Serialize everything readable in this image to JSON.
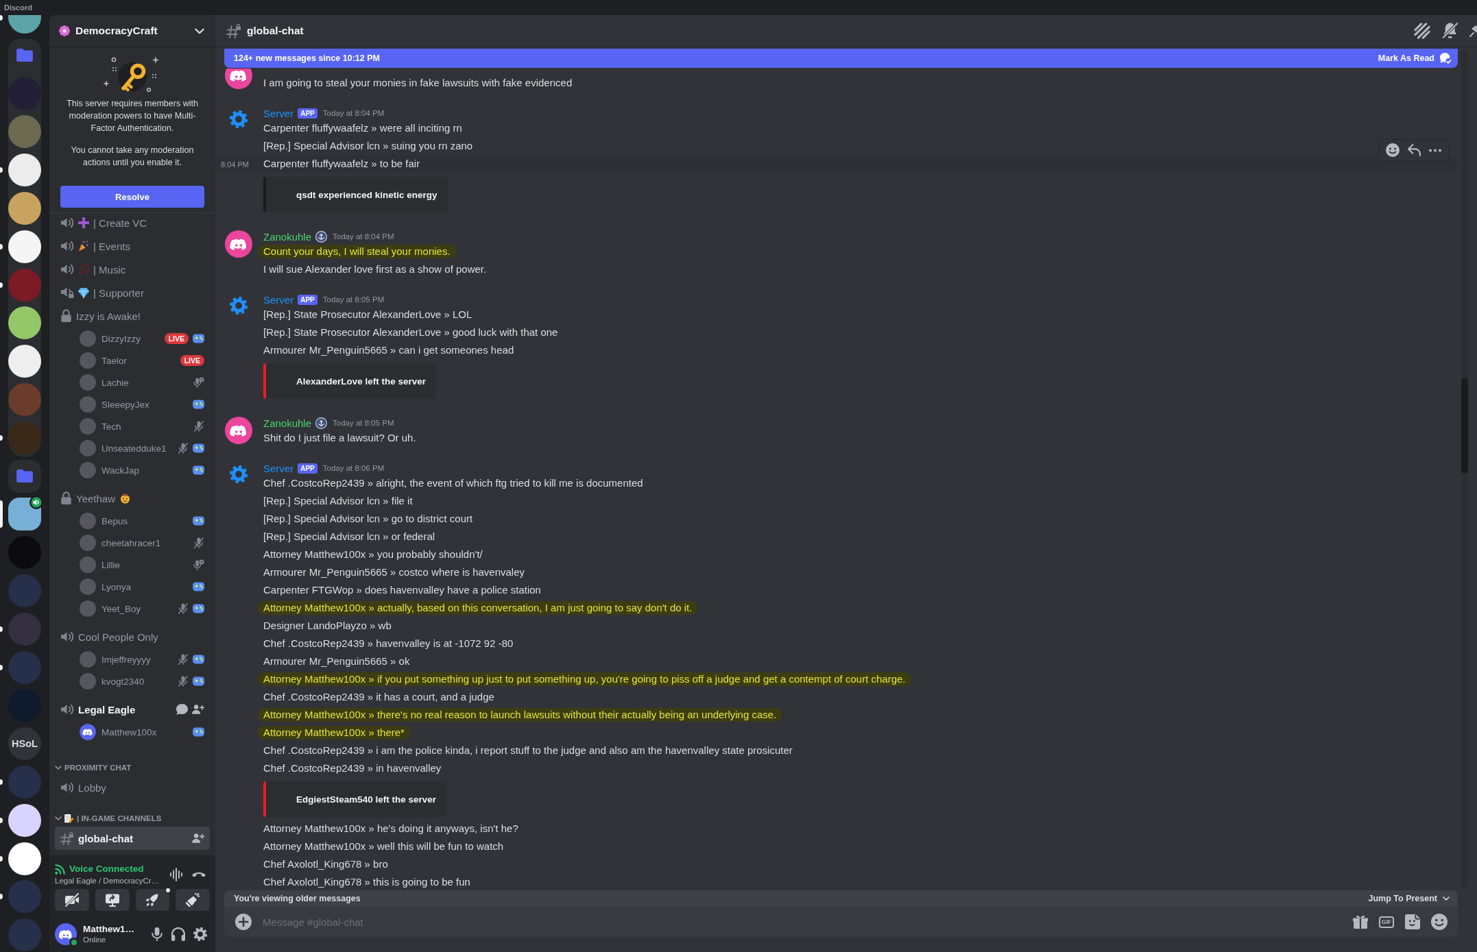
{
  "app": {
    "title": "Discord"
  },
  "servers": [
    {
      "kind": "server",
      "unread": true,
      "selected": false,
      "in_voice": false
    },
    {
      "kind": "folder",
      "children": [
        {
          "kind": "server",
          "unread": false,
          "selected": false,
          "in_voice": false
        },
        {
          "kind": "server",
          "unread": false,
          "selected": false,
          "in_voice": false
        },
        {
          "kind": "server",
          "unread": true,
          "selected": false,
          "in_voice": false
        },
        {
          "kind": "server",
          "unread": false,
          "selected": false,
          "in_voice": false
        },
        {
          "kind": "server",
          "unread": true,
          "selected": false,
          "in_voice": false
        },
        {
          "kind": "server",
          "unread": true,
          "selected": false,
          "in_voice": false
        },
        {
          "kind": "server",
          "unread": false,
          "selected": false,
          "in_voice": false
        },
        {
          "kind": "server",
          "unread": false,
          "selected": false,
          "in_voice": false
        },
        {
          "kind": "server",
          "unread": false,
          "selected": false,
          "in_voice": false
        },
        {
          "kind": "server",
          "unread": true,
          "selected": false,
          "in_voice": false
        }
      ]
    },
    {
      "kind": "folder"
    },
    {
      "kind": "server",
      "unread": false,
      "selected": true,
      "in_voice": true
    },
    {
      "kind": "server",
      "unread": false,
      "selected": false,
      "in_voice": false
    },
    {
      "kind": "server",
      "unread": false,
      "selected": false,
      "in_voice": false
    },
    {
      "kind": "server",
      "unread": true,
      "selected": false,
      "in_voice": false
    },
    {
      "kind": "server",
      "unread": true,
      "selected": false,
      "in_voice": false
    },
    {
      "kind": "server",
      "unread": false,
      "selected": false,
      "in_voice": false
    },
    {
      "kind": "acronym",
      "label": "HSoL",
      "unread": false,
      "selected": false,
      "in_voice": false
    },
    {
      "kind": "server",
      "unread": true,
      "selected": false,
      "in_voice": false
    },
    {
      "kind": "server",
      "unread": true,
      "selected": false,
      "in_voice": false
    },
    {
      "kind": "server",
      "unread": true,
      "selected": false,
      "in_voice": false
    },
    {
      "kind": "server",
      "unread": true,
      "selected": false,
      "in_voice": false
    },
    {
      "kind": "server",
      "unread": false,
      "selected": false,
      "in_voice": false
    }
  ],
  "sidebar": {
    "server_name": "DemocracyCraft",
    "notice": {
      "paragraphs": [
        "This server requires members with moderation powers to have Multi-Factor Authentication.",
        "You cannot take any moderation actions until you enable it."
      ],
      "button": "Resolve"
    },
    "channels": [
      {
        "kind": "voice",
        "name": "| Create VC",
        "selected": false,
        "connected": false
      },
      {
        "kind": "voice",
        "name": "| Events",
        "selected": false,
        "connected": false
      },
      {
        "kind": "voice",
        "name": "| Music",
        "selected": false,
        "connected": false
      },
      {
        "kind": "restricted",
        "name": "| Supporter",
        "selected": false,
        "connected": false
      },
      {
        "kind": "private",
        "name": "Izzy is Awake!",
        "selected": false,
        "connected": false,
        "members": [
          {
            "name": "DizzyIzzy",
            "badge": "LIVE",
            "default_avatar": false,
            "muted": false,
            "suppressed": false,
            "activity": true
          },
          {
            "name": "Taelor",
            "badge": "LIVE",
            "default_avatar": false,
            "muted": false,
            "suppressed": false,
            "activity": false
          },
          {
            "name": "Lachie",
            "default_avatar": false,
            "muted": false,
            "suppressed": true,
            "activity": false
          },
          {
            "name": "SleeepyJex",
            "default_avatar": false,
            "muted": false,
            "suppressed": false,
            "activity": true
          },
          {
            "name": "Tech",
            "default_avatar": false,
            "muted": true,
            "suppressed": false,
            "activity": false
          },
          {
            "name": "Unseatedduke1",
            "default_avatar": false,
            "muted": true,
            "suppressed": false,
            "activity": true
          },
          {
            "name": "WackJap",
            "default_avatar": false,
            "muted": false,
            "suppressed": false,
            "activity": true
          }
        ]
      },
      {
        "kind": "private",
        "name": "Yeethaw",
        "selected": false,
        "connected": false,
        "members": [
          {
            "name": "Bepus",
            "default_avatar": false,
            "muted": false,
            "suppressed": false,
            "activity": true
          },
          {
            "name": "cheetahracer1",
            "default_avatar": false,
            "muted": true,
            "suppressed": false,
            "activity": false
          },
          {
            "name": "Lillie",
            "default_avatar": false,
            "muted": false,
            "suppressed": true,
            "activity": false
          },
          {
            "name": "Lyonya",
            "default_avatar": false,
            "muted": false,
            "suppressed": false,
            "activity": true
          },
          {
            "name": "Yeet_Boy",
            "default_avatar": false,
            "muted": true,
            "suppressed": false,
            "activity": true
          }
        ]
      },
      {
        "kind": "voice",
        "name": "Cool People Only",
        "selected": false,
        "connected": false,
        "members": [
          {
            "name": "Imjeffreyyyy",
            "default_avatar": false,
            "muted": true,
            "suppressed": false,
            "activity": true
          },
          {
            "name": "kvogt2340",
            "default_avatar": false,
            "muted": true,
            "suppressed": false,
            "activity": true
          }
        ]
      },
      {
        "kind": "voice",
        "name": "Legal Eagle",
        "selected": false,
        "connected": true,
        "members": [
          {
            "name": "Matthew100x",
            "default_avatar": true,
            "muted": false,
            "suppressed": false,
            "activity": true
          }
        ]
      },
      {
        "kind": "category",
        "name": "PROXIMITY CHAT",
        "expanded": true,
        "children": [
          {
            "kind": "voice",
            "name": "Lobby",
            "selected": false,
            "connected": false
          }
        ]
      },
      {
        "kind": "category",
        "name": "| IN-GAME CHANNELS",
        "expanded": true,
        "children": [
          {
            "kind": "text",
            "name": "global-chat",
            "selected": true,
            "connected": false
          }
        ]
      }
    ],
    "voice_panel": {
      "status": "Voice Connected",
      "location": "Legal Eagle / DemocracyCr…",
      "actions": [
        {
          "notification": false
        },
        {
          "notification": false
        },
        {
          "notification": true
        },
        {
          "notification": false
        }
      ]
    },
    "user_panel": {
      "name": "Matthew1…",
      "status": "Online",
      "online": true
    }
  },
  "chat": {
    "channel": "global-chat",
    "banner": {
      "text": "124+ new messages since 10:12 PM",
      "action": "Mark As Read"
    },
    "groups": [
      {
        "kind": "user",
        "emblem": false,
        "lines": [
          {
            "kind": "text",
            "text": "I am going to steal your monies in fake lawsuits with fake evidenced",
            "highlighted": false,
            "hovered": false
          }
        ]
      },
      {
        "kind": "bot",
        "author": "Server",
        "color": "#1f8fff",
        "tag": "APP",
        "emblem": false,
        "time": "Today at 8:04 PM",
        "lines": [
          {
            "kind": "text",
            "text": "Carpenter fluffywaafelz » were all inciting rn",
            "highlighted": false,
            "hovered": false
          },
          {
            "kind": "text",
            "text": "[Rep.] Special Advisor lcn » suing you rn zano",
            "highlighted": false,
            "hovered": false
          },
          {
            "kind": "text",
            "text": "Carpenter fluffywaafelz » to be fair",
            "highlighted": false,
            "hovered": true,
            "time": "8:04 PM"
          },
          {
            "kind": "embed",
            "text": "qsdt experienced kinetic energy",
            "color": "#1a1b1e"
          }
        ]
      },
      {
        "kind": "user",
        "author": "Zanokuhle",
        "color": "#4ad66d",
        "emblem": true,
        "time": "Today at 8:04 PM",
        "lines": [
          {
            "kind": "text",
            "text": "Count your days, I will steal your monies.",
            "highlighted": true,
            "hovered": false
          },
          {
            "kind": "text",
            "text": "I will sue Alexander love first as a show of power.",
            "highlighted": false,
            "hovered": false
          }
        ]
      },
      {
        "kind": "bot",
        "author": "Server",
        "color": "#1f8fff",
        "tag": "APP",
        "emblem": false,
        "time": "Today at 8:05 PM",
        "lines": [
          {
            "kind": "text",
            "text": "[Rep.] State Prosecutor AlexanderLove » LOL",
            "highlighted": false,
            "hovered": false
          },
          {
            "kind": "text",
            "text": "[Rep.] State Prosecutor AlexanderLove » good luck with that one",
            "highlighted": false,
            "hovered": false
          },
          {
            "kind": "text",
            "text": "Armourer Mr_Penguin5665 » can i get someones head",
            "highlighted": false,
            "hovered": false
          },
          {
            "kind": "embed",
            "text": "AlexanderLove left the server",
            "color": "#ed1c24"
          }
        ]
      },
      {
        "kind": "user",
        "author": "Zanokuhle",
        "color": "#4ad66d",
        "emblem": true,
        "time": "Today at 8:05 PM",
        "lines": [
          {
            "kind": "text",
            "text": "Shit do I just file a lawsuit? Or uh.",
            "highlighted": false,
            "hovered": false
          }
        ]
      },
      {
        "kind": "bot",
        "author": "Server",
        "color": "#1f8fff",
        "tag": "APP",
        "emblem": false,
        "time": "Today at 8:06 PM",
        "lines": [
          {
            "kind": "text",
            "text": "Chef .CostcoRep2439 » alright, the event of which ftg tried to kill me is documented",
            "highlighted": false,
            "hovered": false
          },
          {
            "kind": "text",
            "text": "[Rep.] Special Advisor lcn » file it",
            "highlighted": false,
            "hovered": false
          },
          {
            "kind": "text",
            "text": "[Rep.] Special Advisor lcn » go to district court",
            "highlighted": false,
            "hovered": false
          },
          {
            "kind": "text",
            "text": "[Rep.] Special Advisor lcn » or federal",
            "highlighted": false,
            "hovered": false
          },
          {
            "kind": "text",
            "text": "Attorney Matthew100x » you probably shouldn't/",
            "highlighted": false,
            "hovered": false
          },
          {
            "kind": "text",
            "text": "Armourer Mr_Penguin5665 » costco where is havenvaley",
            "highlighted": false,
            "hovered": false
          },
          {
            "kind": "text",
            "text": "Carpenter FTGWop » does havenvalley have a police station",
            "highlighted": false,
            "hovered": false
          },
          {
            "kind": "text",
            "text": "Attorney Matthew100x » actually, based on this conversation, I am just going to say don't do it.",
            "highlighted": true,
            "hovered": false
          },
          {
            "kind": "text",
            "text": "Designer LandoPlayzo » wb",
            "highlighted": false,
            "hovered": false
          },
          {
            "kind": "text",
            "text": "Chef .CostcoRep2439 » havenvalley is at -1072 92 -80",
            "highlighted": false,
            "hovered": false
          },
          {
            "kind": "text",
            "text": "Armourer Mr_Penguin5665 » ok",
            "highlighted": false,
            "hovered": false
          },
          {
            "kind": "text",
            "text": "Attorney Matthew100x » if you put something up just to put something up, you're going to piss off a judge and get a contempt of court charge.",
            "highlighted": true,
            "hovered": false
          },
          {
            "kind": "text",
            "text": "Chef .CostcoRep2439 » it has a court, and a judge",
            "highlighted": false,
            "hovered": false
          },
          {
            "kind": "text",
            "text": "Attorney Matthew100x » there's no real reason to launch lawsuits without their actually being an underlying case.",
            "highlighted": true,
            "hovered": false
          },
          {
            "kind": "text",
            "text": "Attorney Matthew100x » there*",
            "highlighted": true,
            "hovered": false
          },
          {
            "kind": "text",
            "text": "Chef .CostcoRep2439 » i am the police kinda, i report stuff to the judge and also am the havenvalley state prosicuter",
            "highlighted": false,
            "hovered": false
          },
          {
            "kind": "text",
            "text": "Chef .CostcoRep2439 » in havenvalley",
            "highlighted": false,
            "hovered": false
          },
          {
            "kind": "embed",
            "text": "EdgiestSteam540 left the server",
            "color": "#ed1c24"
          },
          {
            "kind": "text",
            "text": "Attorney Matthew100x » he's doing it anyways, isn't he?",
            "highlighted": false,
            "hovered": false
          },
          {
            "kind": "text",
            "text": "Attorney Matthew100x » well this will be fun to watch",
            "highlighted": false,
            "hovered": false
          },
          {
            "kind": "text",
            "text": "Chef Axolotl_King678 » bro",
            "highlighted": false,
            "hovered": false
          },
          {
            "kind": "text",
            "text": "Chef Axolotl_King678 » this is going to be fun",
            "highlighted": false,
            "hovered": false
          }
        ]
      }
    ],
    "older": {
      "text": "You're viewing older messages",
      "action": "Jump To Present"
    },
    "composer": {
      "placeholder": "Message #global-chat",
      "gif": "GIF"
    }
  }
}
